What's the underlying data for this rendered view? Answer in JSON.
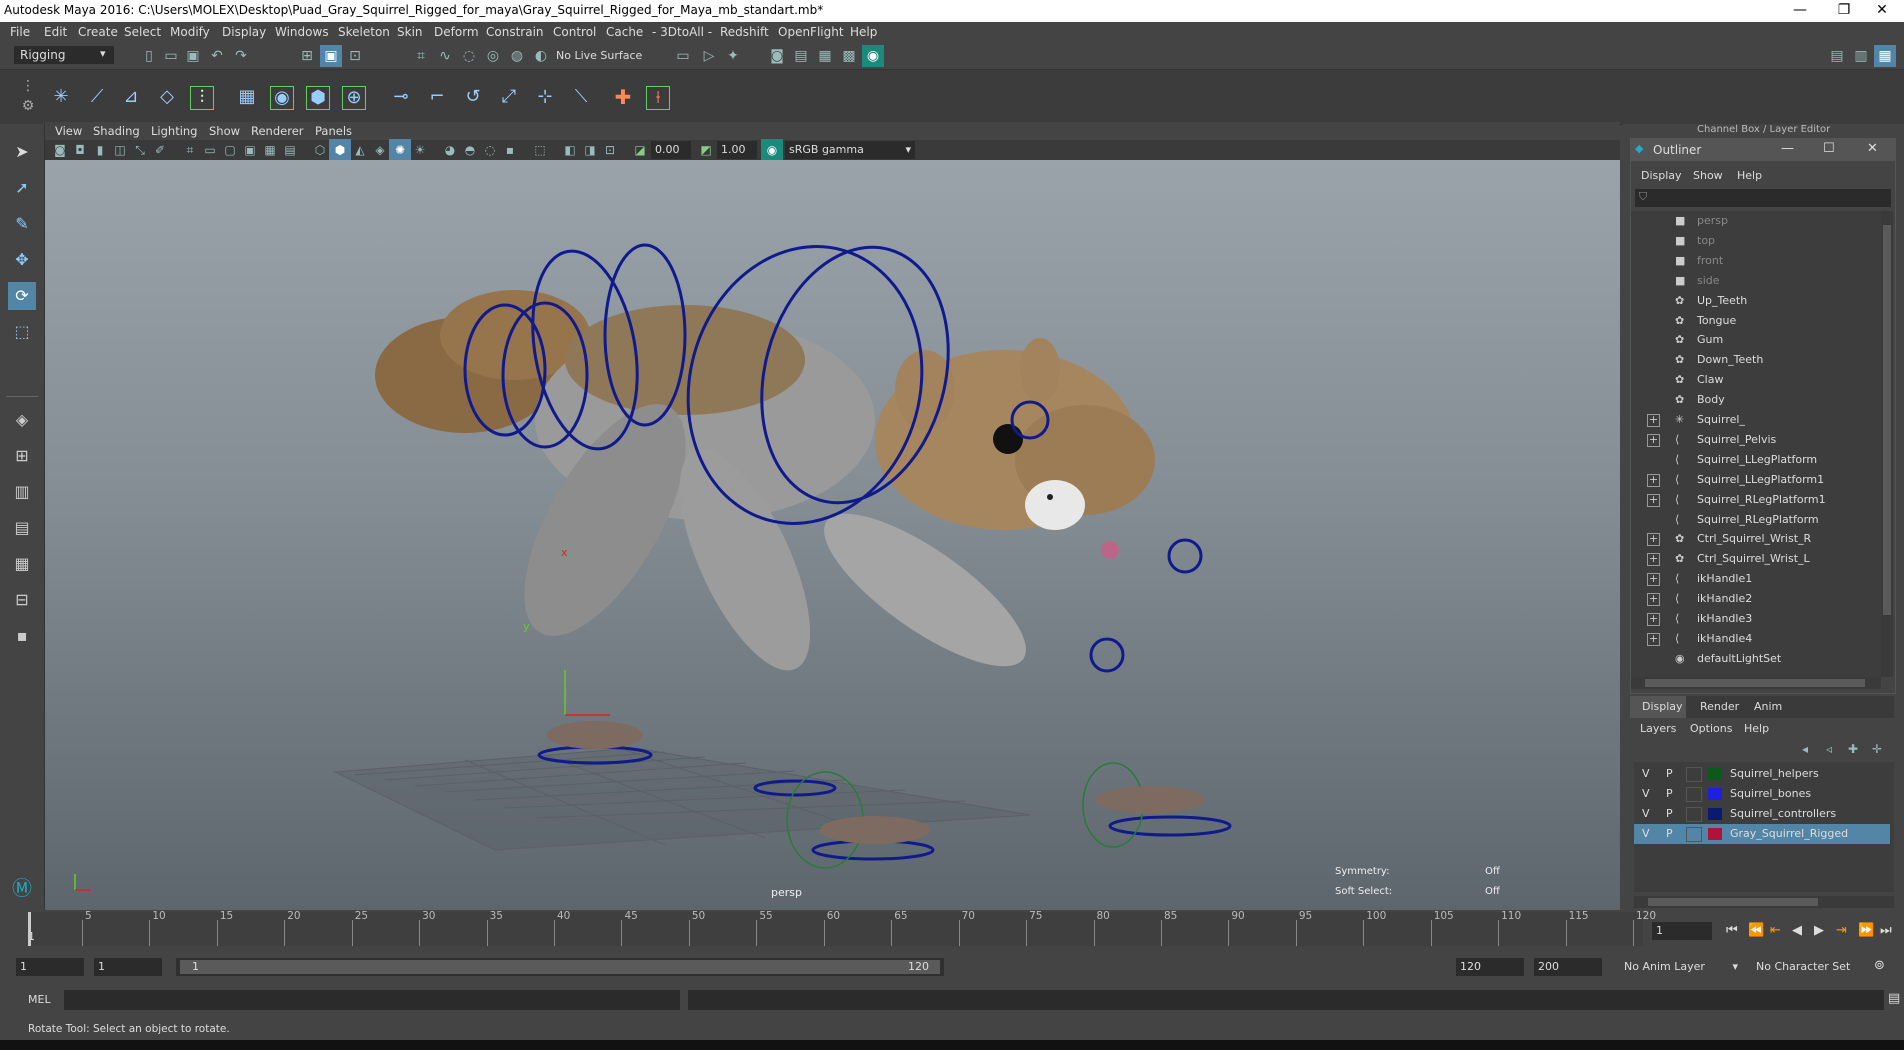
{
  "title": "Autodesk Maya 2016: C:\\Users\\MOLEX\\Desktop\\Puad_Gray_Squirrel_Rigged_for_maya\\Gray_Squirrel_Rigged_for_Maya_mb_standart.mb*",
  "window_controls": {
    "minimize": "—",
    "restore": "❐",
    "close": "✕"
  },
  "menu": [
    "File",
    "Edit",
    "Create",
    "Select",
    "Modify",
    "Display",
    "Windows",
    "Skeleton",
    "Skin",
    "Deform",
    "Constrain",
    "Control",
    "Cache",
    "- 3DtoAll -",
    "Redshift",
    "OpenFlight",
    "Help"
  ],
  "status_line": {
    "mode": "Rigging",
    "live_surface": "No Live Surface"
  },
  "panel_menu": [
    "View",
    "Shading",
    "Lighting",
    "Show",
    "Renderer",
    "Panels"
  ],
  "panel_toolbar": {
    "exposure": "0.00",
    "gamma": "1.00",
    "colorspace": "sRGB gamma"
  },
  "viewport": {
    "camera": "persp",
    "symmetry_label": "Symmetry:",
    "symmetry_value": "Off",
    "soft_select_label": "Soft Select:",
    "soft_select_value": "Off",
    "axis_y": "y",
    "axis_x": "x"
  },
  "channel_box_title": "Channel Box / Layer Editor",
  "outliner": {
    "title": "Outliner",
    "menu": [
      "Display",
      "Show",
      "Help"
    ],
    "items": [
      {
        "label": "persp",
        "icon": "camera-icon",
        "expand": false,
        "dim": true
      },
      {
        "label": "top",
        "icon": "camera-icon",
        "expand": false,
        "dim": true
      },
      {
        "label": "front",
        "icon": "camera-icon",
        "expand": false,
        "dim": true
      },
      {
        "label": "side",
        "icon": "camera-icon",
        "expand": false,
        "dim": true
      },
      {
        "label": "Up_Teeth",
        "icon": "mesh-icon",
        "expand": false
      },
      {
        "label": "Tongue",
        "icon": "mesh-icon",
        "expand": false
      },
      {
        "label": "Gum",
        "icon": "mesh-icon",
        "expand": false
      },
      {
        "label": "Down_Teeth",
        "icon": "mesh-icon",
        "expand": false
      },
      {
        "label": "Claw",
        "icon": "mesh-icon",
        "expand": false
      },
      {
        "label": "Body",
        "icon": "mesh-icon",
        "expand": false
      },
      {
        "label": "Squirrel_",
        "icon": "joint-root-icon",
        "expand": true
      },
      {
        "label": "Squirrel_Pelvis",
        "icon": "joint-icon",
        "expand": true
      },
      {
        "label": "Squirrel_LLegPlatform",
        "icon": "joint-icon",
        "expand": false
      },
      {
        "label": "Squirrel_LLegPlatform1",
        "icon": "joint-icon",
        "expand": true
      },
      {
        "label": "Squirrel_RLegPlatform1",
        "icon": "joint-icon",
        "expand": true
      },
      {
        "label": "Squirrel_RLegPlatform",
        "icon": "joint-icon",
        "expand": false
      },
      {
        "label": "Ctrl_Squirrel_Wrist_R",
        "icon": "curve-icon",
        "expand": true
      },
      {
        "label": "Ctrl_Squirrel_Wrist_L",
        "icon": "curve-icon",
        "expand": true
      },
      {
        "label": "ikHandle1",
        "icon": "ik-handle-icon",
        "expand": true
      },
      {
        "label": "ikHandle2",
        "icon": "ik-handle-icon",
        "expand": true
      },
      {
        "label": "ikHandle3",
        "icon": "ik-handle-icon",
        "expand": true
      },
      {
        "label": "ikHandle4",
        "icon": "ik-handle-icon",
        "expand": true
      },
      {
        "label": "defaultLightSet",
        "icon": "set-icon",
        "expand": false
      }
    ]
  },
  "layer_editor": {
    "tabs": [
      "Display",
      "Render",
      "Anim"
    ],
    "menu": [
      "Layers",
      "Options",
      "Help"
    ],
    "layers": [
      {
        "v": "V",
        "p": "P",
        "name": "Squirrel_helpers",
        "color": "#0a5a1a",
        "selected": false
      },
      {
        "v": "V",
        "p": "P",
        "name": "Squirrel_bones",
        "color": "#1f1fe0",
        "selected": false
      },
      {
        "v": "V",
        "p": "P",
        "name": "Squirrel_controllers",
        "color": "#0b1a70",
        "selected": false
      },
      {
        "v": "V",
        "p": "P",
        "name": "Gray_Squirrel_Rigged",
        "color": "#b0123a",
        "selected": true
      }
    ]
  },
  "timeline": {
    "ticks": [
      "5",
      "10",
      "15",
      "20",
      "25",
      "30",
      "35",
      "40",
      "45",
      "50",
      "55",
      "60",
      "65",
      "70",
      "75",
      "80",
      "85",
      "90",
      "95",
      "100",
      "105",
      "110",
      "115",
      "120"
    ],
    "first": "1",
    "current_frame": "1"
  },
  "range": {
    "start": "1",
    "playback_start": "1",
    "range_start_label": "1",
    "range_end_label": "120",
    "playback_end": "120",
    "end": "200",
    "anim_layer": "No Anim Layer",
    "character_set": "No Character Set"
  },
  "command_line": {
    "lang": "MEL"
  },
  "help_line": "Rotate Tool: Select an object to rotate.",
  "colors": {
    "accent": "#5285a6",
    "rig_blue": "#101a8c",
    "background": "#444444"
  }
}
